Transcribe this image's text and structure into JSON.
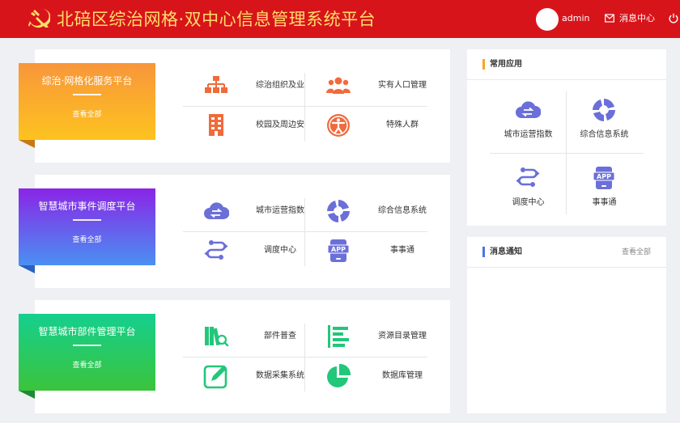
{
  "header": {
    "title": "北碚区综治网格·双中心信息管理系统平台",
    "user": "admin",
    "messages_label": "消息中心",
    "brand_color": "#d8141b",
    "title_color": "#ffde6b"
  },
  "platforms": [
    {
      "title": "综治·网格化服务平台",
      "link": "查看全部",
      "colors": [
        "#f8963b",
        "#fdc31f"
      ],
      "icon_color": "#f06a3c",
      "tiles": [
        {
          "label": "综治组织及业",
          "icon": "org-chart-icon"
        },
        {
          "label": "实有人口管理",
          "icon": "people-group-icon"
        },
        {
          "label": "校园及周边安",
          "icon": "building-icon"
        },
        {
          "label": "特殊人群",
          "icon": "person-circle-icon"
        }
      ]
    },
    {
      "title": "智慧城市事件调度平台",
      "link": "查看全部",
      "colors": [
        "#8a25e6",
        "#4a90f2"
      ],
      "icon_color": "#6b6fd8",
      "tiles": [
        {
          "label": "城市运营指数",
          "icon": "cloud-exchange-icon"
        },
        {
          "label": "综合信息系统",
          "icon": "ring-segments-icon"
        },
        {
          "label": "调度中心",
          "icon": "dispatch-icon"
        },
        {
          "label": "事事通",
          "icon": "app-phone-icon"
        }
      ]
    },
    {
      "title": "智慧城市部件管理平台",
      "link": "查看全部",
      "colors": [
        "#15cf8e",
        "#3bc43c"
      ],
      "icon_color": "#22c77a",
      "tiles": [
        {
          "label": "部件普查",
          "icon": "books-search-icon"
        },
        {
          "label": "资源目录管理",
          "icon": "catalog-bars-icon"
        },
        {
          "label": "数据采集系统",
          "icon": "edit-box-icon"
        },
        {
          "label": "数据库管理",
          "icon": "pie-icon"
        }
      ]
    }
  ],
  "common_apps": {
    "title": "常用应用",
    "icon_color": "#6b6fd8",
    "items": [
      {
        "label": "城市运营指数",
        "icon": "cloud-exchange-icon"
      },
      {
        "label": "综合信息系统",
        "icon": "ring-segments-icon"
      },
      {
        "label": "调度中心",
        "icon": "dispatch-icon"
      },
      {
        "label": "事事通",
        "icon": "app-phone-icon"
      }
    ]
  },
  "notices": {
    "title": "消息通知",
    "more": "查看全部"
  }
}
